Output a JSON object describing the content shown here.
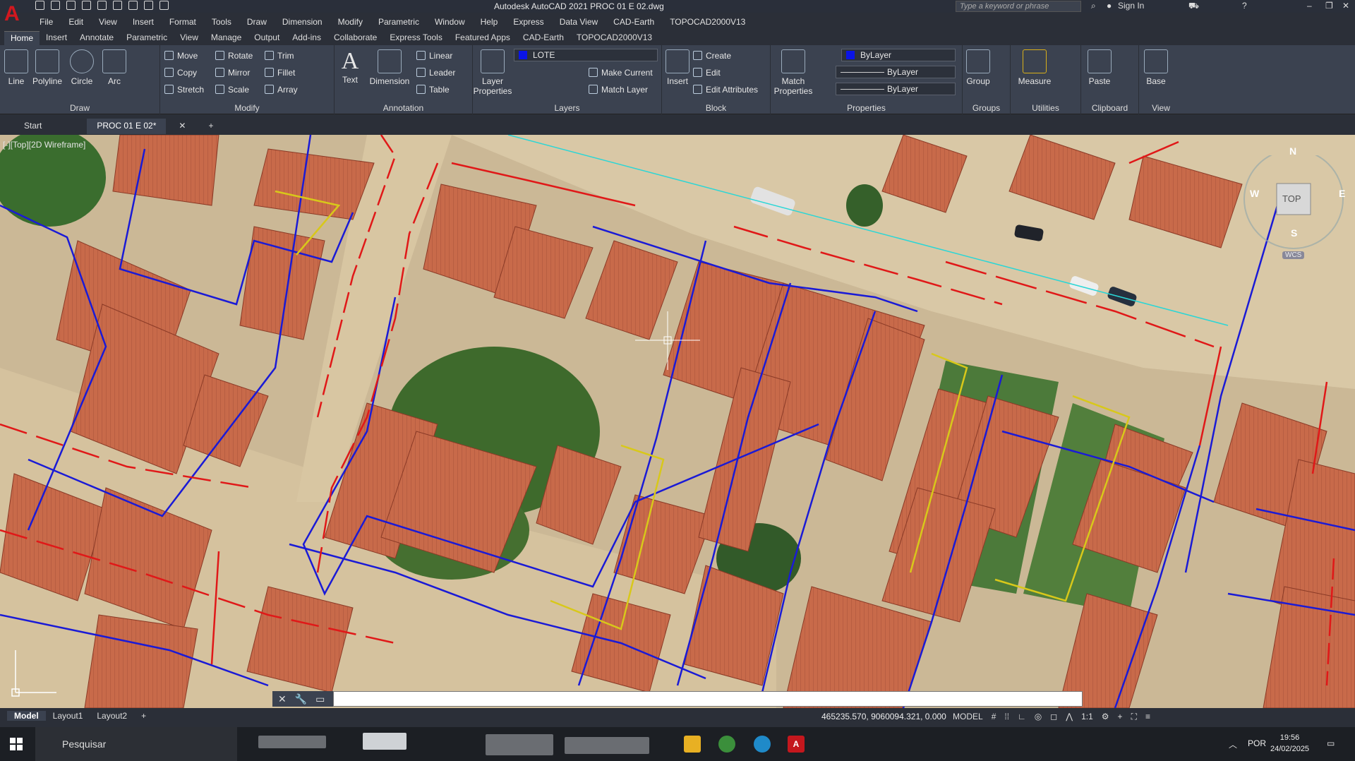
{
  "app": {
    "title": "Autodesk AutoCAD 2021    PROC 01 E 02.dwg",
    "search_placeholder": "Type a keyword or phrase",
    "sign_in": "Sign In"
  },
  "menu": [
    "File",
    "Edit",
    "View",
    "Insert",
    "Format",
    "Tools",
    "Draw",
    "Dimension",
    "Modify",
    "Parametric",
    "Window",
    "Help",
    "Express",
    "Data View",
    "CAD-Earth",
    "TOPOCAD2000V13"
  ],
  "ribbon_tabs": [
    "Home",
    "Insert",
    "Annotate",
    "Parametric",
    "View",
    "Manage",
    "Output",
    "Add-ins",
    "Collaborate",
    "Express Tools",
    "Featured Apps",
    "CAD-Earth",
    "TOPOCAD2000V13"
  ],
  "draw": {
    "label": "Draw",
    "line": "Line",
    "polyline": "Polyline",
    "circle": "Circle",
    "arc": "Arc"
  },
  "modify": {
    "label": "Modify",
    "move": "Move",
    "rotate": "Rotate",
    "trim": "Trim",
    "copy": "Copy",
    "mirror": "Mirror",
    "fillet": "Fillet",
    "stretch": "Stretch",
    "scale": "Scale",
    "array": "Array"
  },
  "annotation": {
    "label": "Annotation",
    "text": "Text",
    "dimension": "Dimension",
    "linear": "Linear",
    "leader": "Leader",
    "table": "Table"
  },
  "layers": {
    "label": "Layers",
    "layer_properties": "Layer Properties",
    "current_layer": "LOTE",
    "make_current": "Make Current",
    "match_layer": "Match Layer"
  },
  "block": {
    "label": "Block",
    "insert": "Insert",
    "create": "Create",
    "edit": "Edit",
    "edit_attributes": "Edit Attributes"
  },
  "properties": {
    "label": "Properties",
    "match_properties": "Match Properties",
    "color": "ByLayer",
    "linetype": "ByLayer",
    "lineweight": "ByLayer"
  },
  "groups": {
    "label": "Groups",
    "group": "Group"
  },
  "utilities": {
    "label": "Utilities",
    "measure": "Measure"
  },
  "clipboard": {
    "label": "Clipboard",
    "paste": "Paste"
  },
  "view": {
    "label": "View",
    "base": "Base"
  },
  "doc_tabs": {
    "start": "Start",
    "active": "PROC 01 E 02*"
  },
  "viewport_label": "[-][Top][2D Wireframe]",
  "navcube": {
    "top": "TOP",
    "n": "N",
    "s": "S",
    "e": "E",
    "w": "W",
    "wcs": "WCS"
  },
  "layout_tabs": [
    "Model",
    "Layout1",
    "Layout2"
  ],
  "status": {
    "coords": "465235.570, 9060094.321, 0.000",
    "mode": "MODEL",
    "scale": "1:1"
  },
  "taskbar": {
    "search": "Pesquisar",
    "lang": "POR",
    "time": "19:56",
    "date": "24/02/2025"
  },
  "colors": {
    "red_lines": "#e01818",
    "blue_lines": "#1a1ad6",
    "yellow_lines": "#d8c81a",
    "cyan_line": "#2ad6d6"
  }
}
